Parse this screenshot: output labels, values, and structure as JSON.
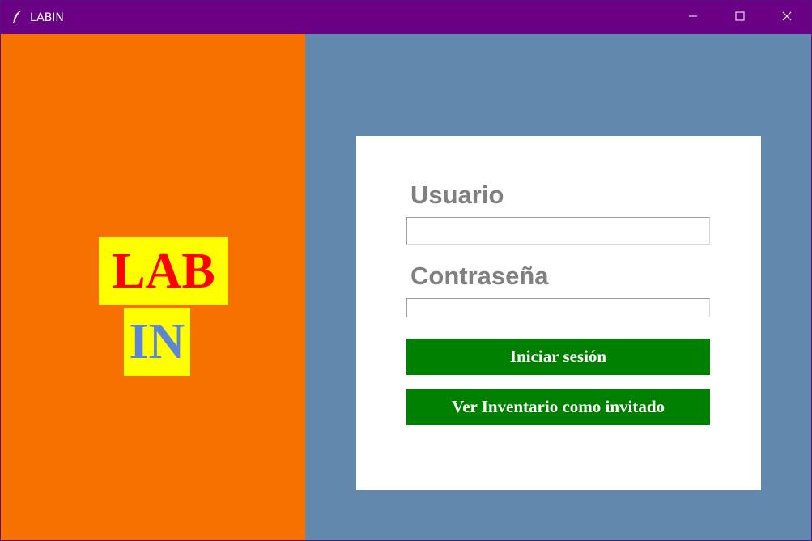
{
  "window": {
    "title": "LABIN",
    "controls": {
      "minimize_icon": "minimize-icon",
      "maximize_icon": "maximize-icon",
      "close_icon": "close-icon"
    },
    "titlebar_color": "#6a0084"
  },
  "logo": {
    "line1": "LAB",
    "line2": "IN",
    "line1_color": "#ff0000",
    "line2_color": "#5c85d6",
    "background_color": "#ffff00"
  },
  "left_panel": {
    "background_color": "#f77100"
  },
  "right_panel": {
    "background_color": "#6289ad"
  },
  "login": {
    "username_label": "Usuario",
    "username_value": "",
    "password_label": "Contraseña",
    "password_value": "",
    "login_button": "Iniciar sesión",
    "guest_button": "Ver Inventario como invitado",
    "button_color": "#008000"
  }
}
